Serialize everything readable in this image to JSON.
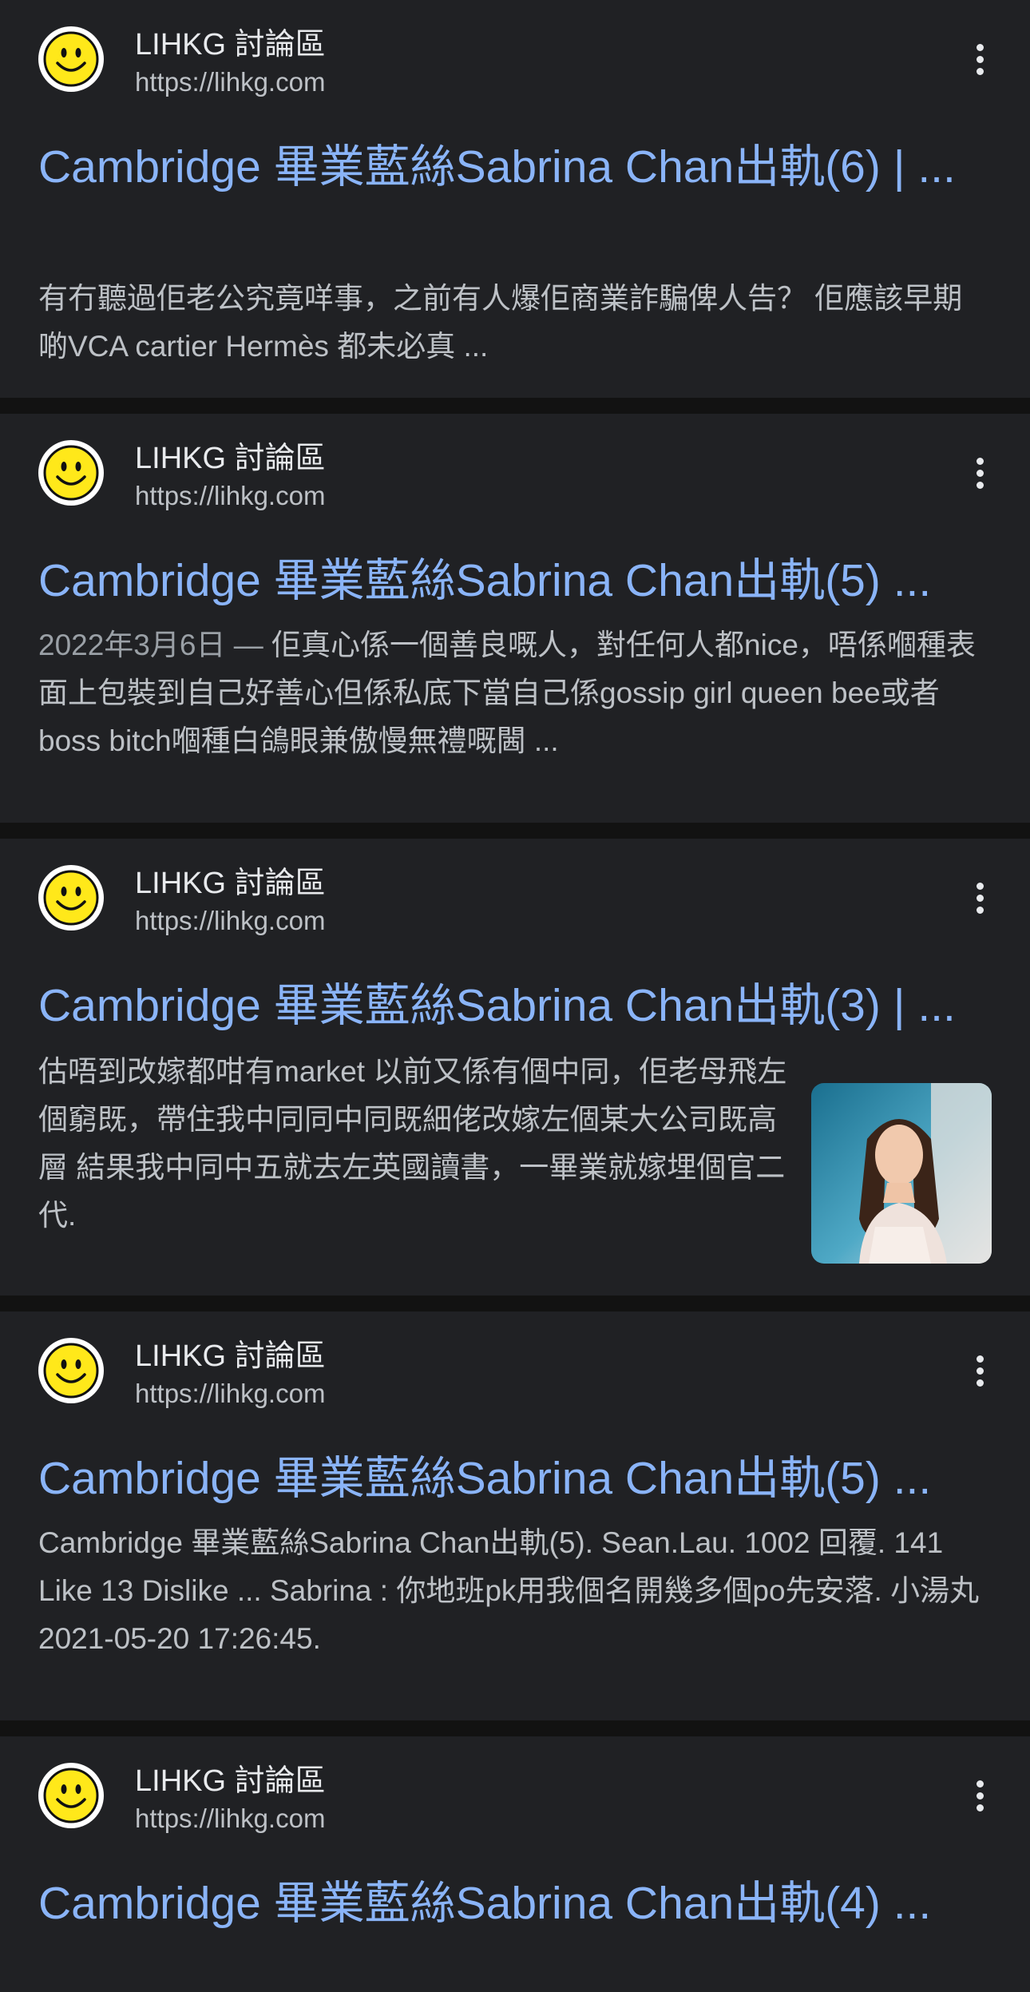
{
  "colors": {
    "background": "#121212",
    "card": "#202124",
    "title_link": "#8ab4f8",
    "snippet_text": "#bdc1c6",
    "date_text": "#9aa0a6",
    "favicon_yellow": "#ffe81a"
  },
  "results": [
    {
      "site_name": "LIHKG 討論區",
      "site_url": "https://lihkg.com",
      "favicon": "smiley-face-icon",
      "title": "Cambridge 畢業藍絲Sabrina Chan出軌(6) | ...",
      "snippet": "有冇聽過佢老公究竟咩事，之前有人爆佢商業詐騙俾人告？ 佢應該早期啲VCA cartier Hermès 都未必真 ..."
    },
    {
      "site_name": "LIHKG 討論區",
      "site_url": "https://lihkg.com",
      "favicon": "smiley-face-icon",
      "title": "Cambridge 畢業藍絲Sabrina Chan出軌(5) ...",
      "date": "2022年3月6日",
      "snippet": "佢真心係一個善良嘅人，對任何人都nice，唔係嗰種表面上包裝到自己好善心但係私底下當自己係gossip girl queen bee或者boss bitch嗰種白鴿眼兼傲慢無禮嘅閪 ..."
    },
    {
      "site_name": "LIHKG 討論區",
      "site_url": "https://lihkg.com",
      "favicon": "smiley-face-icon",
      "title": "Cambridge 畢業藍絲Sabrina Chan出軌(3) | ...",
      "snippet": "估唔到改嫁都咁有market 以前又係有個中同，佢老母飛左個窮既，帶住我中同同中同既細佬改嫁左個某大公司既高層 結果我中同中五就去左英國讀書，一畢業就嫁埋個官二代.",
      "thumbnail": "woman-portrait-thumbnail"
    },
    {
      "site_name": "LIHKG 討論區",
      "site_url": "https://lihkg.com",
      "favicon": "smiley-face-icon",
      "title": "Cambridge 畢業藍絲Sabrina Chan出軌(5) ...",
      "snippet": "Cambridge 畢業藍絲Sabrina Chan出軌(5). Sean.Lau. 1002 回覆. 141 Like 13 Dislike ... Sabrina : 你地班pk用我個名開幾多個po先安落. 小湯丸 2021-05-20 17:26:45."
    },
    {
      "site_name": "LIHKG 討論區",
      "site_url": "https://lihkg.com",
      "favicon": "smiley-face-icon",
      "title": "Cambridge 畢業藍絲Sabrina Chan出軌(4) ...",
      "snippet": ""
    }
  ],
  "separator": "—"
}
